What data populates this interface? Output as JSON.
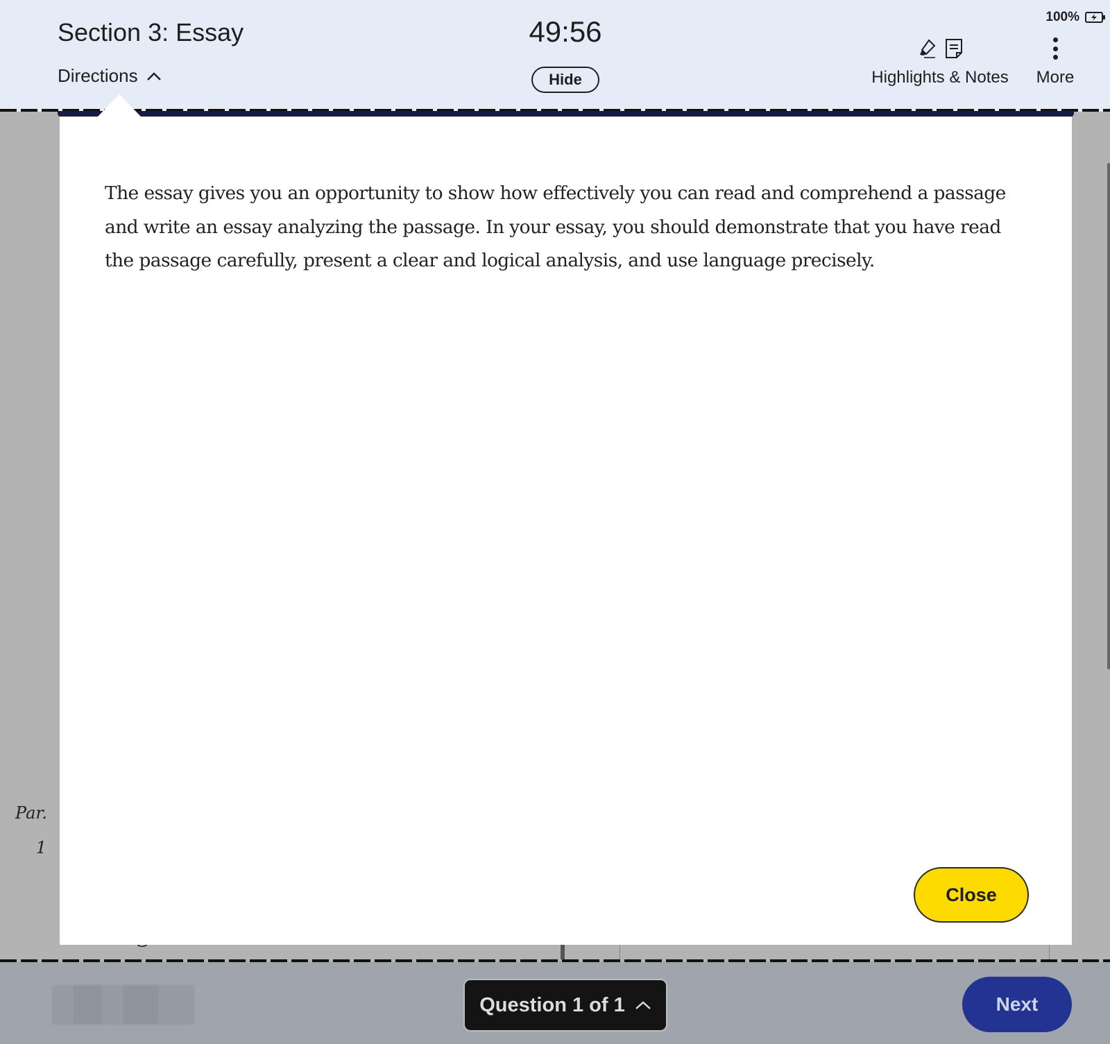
{
  "header": {
    "section_title": "Section 3: Essay",
    "directions_label": "Directions",
    "timer": "49:56",
    "hide_label": "Hide",
    "highlights_notes_label": "Highlights & Notes",
    "more_label": "More",
    "battery_percent": "100%"
  },
  "directions_modal": {
    "text": "The essay gives you an opportunity to show how effectively you can read and comprehend a passage and write an essay analyzing the passage. In your essay, you should demonstrate that you have read the passage carefully, present a clear and logical analysis, and use language precisely.",
    "close_label": "Close"
  },
  "passage": {
    "par_label": "Par.",
    "par_number": "1",
    "peek_text": "knew night skies in which meteors left"
  },
  "footer": {
    "question_nav_label": "Question 1 of 1",
    "next_label": "Next"
  },
  "colors": {
    "header_bg": "#e6ecf7",
    "close_button": "#fedb00",
    "next_button": "#233391",
    "question_nav_bg": "#141414",
    "footer_bg": "#a0a4ad"
  }
}
